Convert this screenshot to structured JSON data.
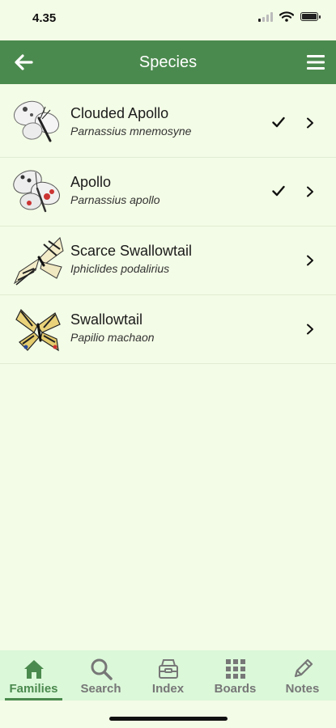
{
  "status": {
    "time": "4.35"
  },
  "header": {
    "title": "Species"
  },
  "species": [
    {
      "common": "Clouded Apollo",
      "latin": "Parnassius mnemosyne",
      "checked": true
    },
    {
      "common": "Apollo",
      "latin": "Parnassius apollo",
      "checked": true
    },
    {
      "common": "Scarce Swallowtail",
      "latin": "Iphiclides podalirius",
      "checked": false
    },
    {
      "common": "Swallowtail",
      "latin": "Papilio machaon",
      "checked": false
    }
  ],
  "tabs": [
    {
      "label": "Families",
      "icon": "home-icon",
      "active": true
    },
    {
      "label": "Search",
      "icon": "search-icon",
      "active": false
    },
    {
      "label": "Index",
      "icon": "index-icon",
      "active": false
    },
    {
      "label": "Boards",
      "icon": "grid-icon",
      "active": false
    },
    {
      "label": "Notes",
      "icon": "pencil-icon",
      "active": false
    }
  ],
  "colors": {
    "brand": "#4b8a4e",
    "background": "#f3fce6",
    "tabbar": "#dbf8d9"
  }
}
